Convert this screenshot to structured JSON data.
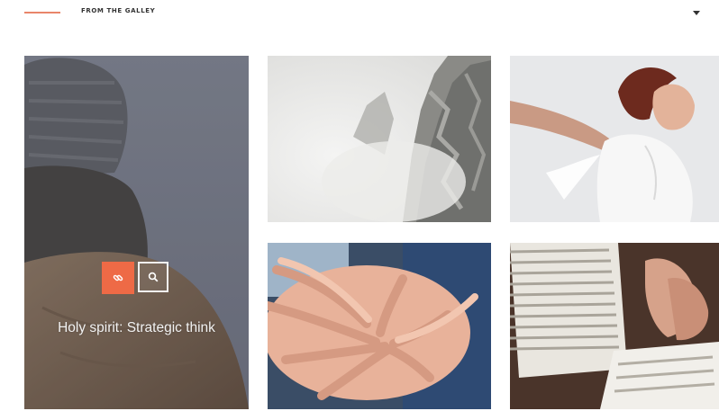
{
  "header": {
    "title": "FROM THE GALLEY",
    "accent_color": "#e9856a",
    "toggle_icon": "chevron-down-icon"
  },
  "gallery": {
    "featured": {
      "caption": "Holy spirit: Strategic think",
      "link_icon": "link-icon",
      "zoom_icon": "search-icon",
      "accent_color": "#ee6a46"
    },
    "items": [
      {
        "image": "misty-cliff-photo"
      },
      {
        "image": "joyful-woman-photo"
      },
      {
        "image": "stacked-hands-photo"
      },
      {
        "image": "open-bible-photo"
      }
    ]
  }
}
